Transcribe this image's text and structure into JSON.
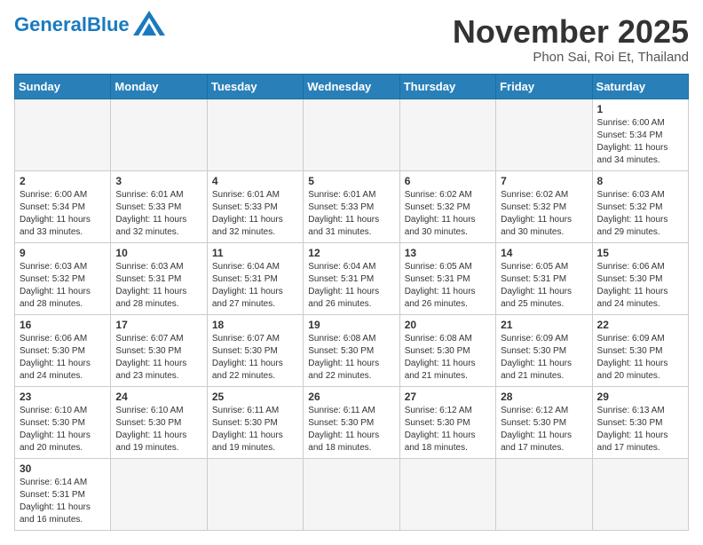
{
  "header": {
    "logo_general": "General",
    "logo_blue": "Blue",
    "month_title": "November 2025",
    "location": "Phon Sai, Roi Et, Thailand"
  },
  "days_of_week": [
    "Sunday",
    "Monday",
    "Tuesday",
    "Wednesday",
    "Thursday",
    "Friday",
    "Saturday"
  ],
  "days": [
    {
      "num": "",
      "info": ""
    },
    {
      "num": "",
      "info": ""
    },
    {
      "num": "",
      "info": ""
    },
    {
      "num": "",
      "info": ""
    },
    {
      "num": "",
      "info": ""
    },
    {
      "num": "",
      "info": ""
    },
    {
      "num": "1",
      "sunrise": "6:00 AM",
      "sunset": "5:34 PM",
      "daylight": "11 hours and 34 minutes."
    },
    {
      "num": "2",
      "sunrise": "6:00 AM",
      "sunset": "5:34 PM",
      "daylight": "11 hours and 33 minutes."
    },
    {
      "num": "3",
      "sunrise": "6:01 AM",
      "sunset": "5:33 PM",
      "daylight": "11 hours and 32 minutes."
    },
    {
      "num": "4",
      "sunrise": "6:01 AM",
      "sunset": "5:33 PM",
      "daylight": "11 hours and 32 minutes."
    },
    {
      "num": "5",
      "sunrise": "6:01 AM",
      "sunset": "5:33 PM",
      "daylight": "11 hours and 31 minutes."
    },
    {
      "num": "6",
      "sunrise": "6:02 AM",
      "sunset": "5:32 PM",
      "daylight": "11 hours and 30 minutes."
    },
    {
      "num": "7",
      "sunrise": "6:02 AM",
      "sunset": "5:32 PM",
      "daylight": "11 hours and 30 minutes."
    },
    {
      "num": "8",
      "sunrise": "6:03 AM",
      "sunset": "5:32 PM",
      "daylight": "11 hours and 29 minutes."
    },
    {
      "num": "9",
      "sunrise": "6:03 AM",
      "sunset": "5:32 PM",
      "daylight": "11 hours and 28 minutes."
    },
    {
      "num": "10",
      "sunrise": "6:03 AM",
      "sunset": "5:31 PM",
      "daylight": "11 hours and 28 minutes."
    },
    {
      "num": "11",
      "sunrise": "6:04 AM",
      "sunset": "5:31 PM",
      "daylight": "11 hours and 27 minutes."
    },
    {
      "num": "12",
      "sunrise": "6:04 AM",
      "sunset": "5:31 PM",
      "daylight": "11 hours and 26 minutes."
    },
    {
      "num": "13",
      "sunrise": "6:05 AM",
      "sunset": "5:31 PM",
      "daylight": "11 hours and 26 minutes."
    },
    {
      "num": "14",
      "sunrise": "6:05 AM",
      "sunset": "5:31 PM",
      "daylight": "11 hours and 25 minutes."
    },
    {
      "num": "15",
      "sunrise": "6:06 AM",
      "sunset": "5:30 PM",
      "daylight": "11 hours and 24 minutes."
    },
    {
      "num": "16",
      "sunrise": "6:06 AM",
      "sunset": "5:30 PM",
      "daylight": "11 hours and 24 minutes."
    },
    {
      "num": "17",
      "sunrise": "6:07 AM",
      "sunset": "5:30 PM",
      "daylight": "11 hours and 23 minutes."
    },
    {
      "num": "18",
      "sunrise": "6:07 AM",
      "sunset": "5:30 PM",
      "daylight": "11 hours and 22 minutes."
    },
    {
      "num": "19",
      "sunrise": "6:08 AM",
      "sunset": "5:30 PM",
      "daylight": "11 hours and 22 minutes."
    },
    {
      "num": "20",
      "sunrise": "6:08 AM",
      "sunset": "5:30 PM",
      "daylight": "11 hours and 21 minutes."
    },
    {
      "num": "21",
      "sunrise": "6:09 AM",
      "sunset": "5:30 PM",
      "daylight": "11 hours and 21 minutes."
    },
    {
      "num": "22",
      "sunrise": "6:09 AM",
      "sunset": "5:30 PM",
      "daylight": "11 hours and 20 minutes."
    },
    {
      "num": "23",
      "sunrise": "6:10 AM",
      "sunset": "5:30 PM",
      "daylight": "11 hours and 20 minutes."
    },
    {
      "num": "24",
      "sunrise": "6:10 AM",
      "sunset": "5:30 PM",
      "daylight": "11 hours and 19 minutes."
    },
    {
      "num": "25",
      "sunrise": "6:11 AM",
      "sunset": "5:30 PM",
      "daylight": "11 hours and 19 minutes."
    },
    {
      "num": "26",
      "sunrise": "6:11 AM",
      "sunset": "5:30 PM",
      "daylight": "11 hours and 18 minutes."
    },
    {
      "num": "27",
      "sunrise": "6:12 AM",
      "sunset": "5:30 PM",
      "daylight": "11 hours and 18 minutes."
    },
    {
      "num": "28",
      "sunrise": "6:12 AM",
      "sunset": "5:30 PM",
      "daylight": "11 hours and 17 minutes."
    },
    {
      "num": "29",
      "sunrise": "6:13 AM",
      "sunset": "5:30 PM",
      "daylight": "11 hours and 17 minutes."
    },
    {
      "num": "30",
      "sunrise": "6:14 AM",
      "sunset": "5:31 PM",
      "daylight": "11 hours and 16 minutes."
    }
  ],
  "labels": {
    "sunrise": "Sunrise:",
    "sunset": "Sunset:",
    "daylight": "Daylight:"
  }
}
